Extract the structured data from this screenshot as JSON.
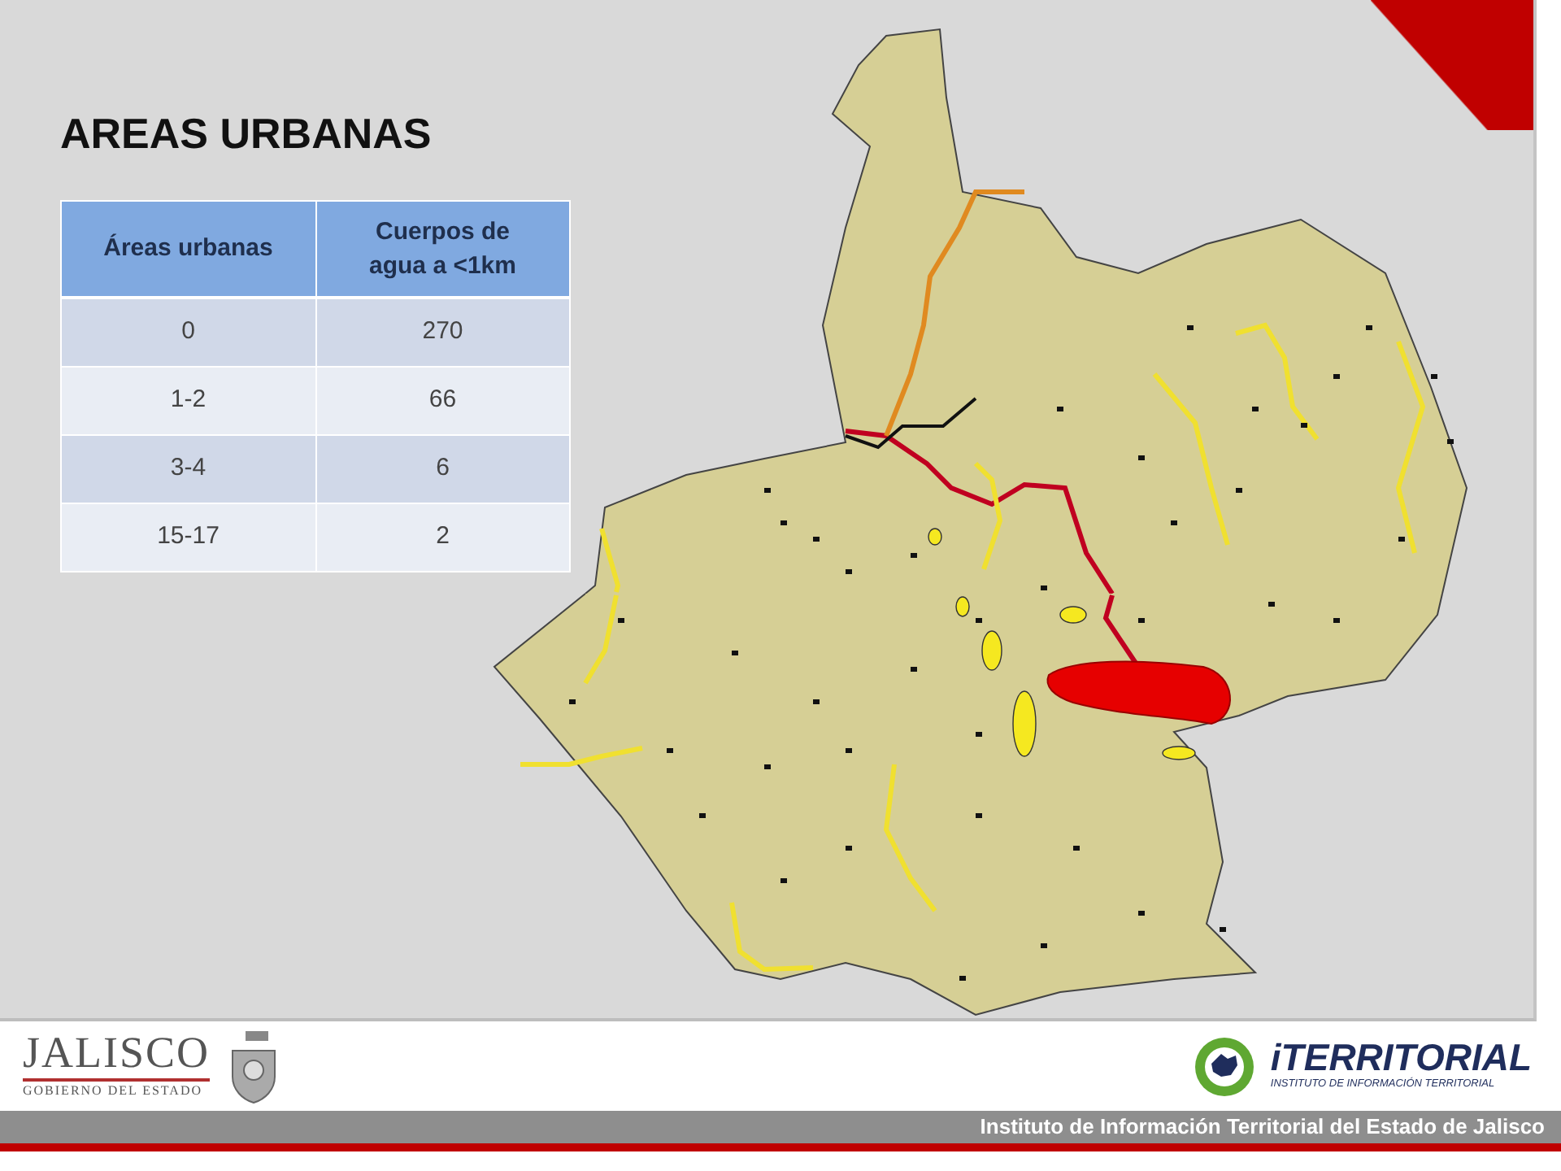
{
  "slide": {
    "title": "AREAS URBANAS"
  },
  "table": {
    "columns": [
      "Áreas urbanas",
      "Cuerpos de agua a <1km"
    ],
    "rows": [
      [
        "0",
        "270"
      ],
      [
        "1-2",
        "66"
      ],
      [
        "3-4",
        "6"
      ],
      [
        "15-17",
        "2"
      ]
    ]
  },
  "footer": {
    "logos": [
      {
        "name": "JALISCO",
        "subtitle": "GOBIERNO DEL ESTADO"
      },
      {
        "name": "iTERRITORIAL",
        "subtitle": "INSTITUTO DE INFORMACIÓN TERRITORIAL"
      }
    ],
    "caption": "Instituto de Información Territorial del Estado de Jalisco"
  }
}
